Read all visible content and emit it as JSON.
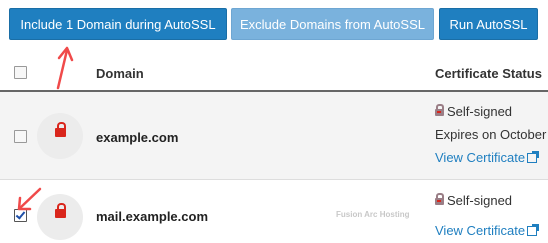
{
  "toolbar": {
    "include_label": "Include 1 Domain during AutoSSL",
    "exclude_label": "Exclude Domains from AutoSSL",
    "run_label": "Run AutoSSL"
  },
  "table": {
    "headers": {
      "domain": "Domain",
      "status": "Certificate Status"
    },
    "rows": [
      {
        "checked": false,
        "domain": "example.com",
        "status": "Self-signed",
        "expires": "Expires on October",
        "link": "View Certificate"
      },
      {
        "checked": true,
        "domain": "mail.example.com",
        "status": "Self-signed",
        "link": "View Certificate"
      }
    ]
  },
  "watermark": "Fusion Arc Hosting",
  "colors": {
    "primary": "#1f7fc0",
    "disabled": "#7ab2dd",
    "lock": "#d9261c",
    "annotation_arrow": "#f04a4a"
  }
}
